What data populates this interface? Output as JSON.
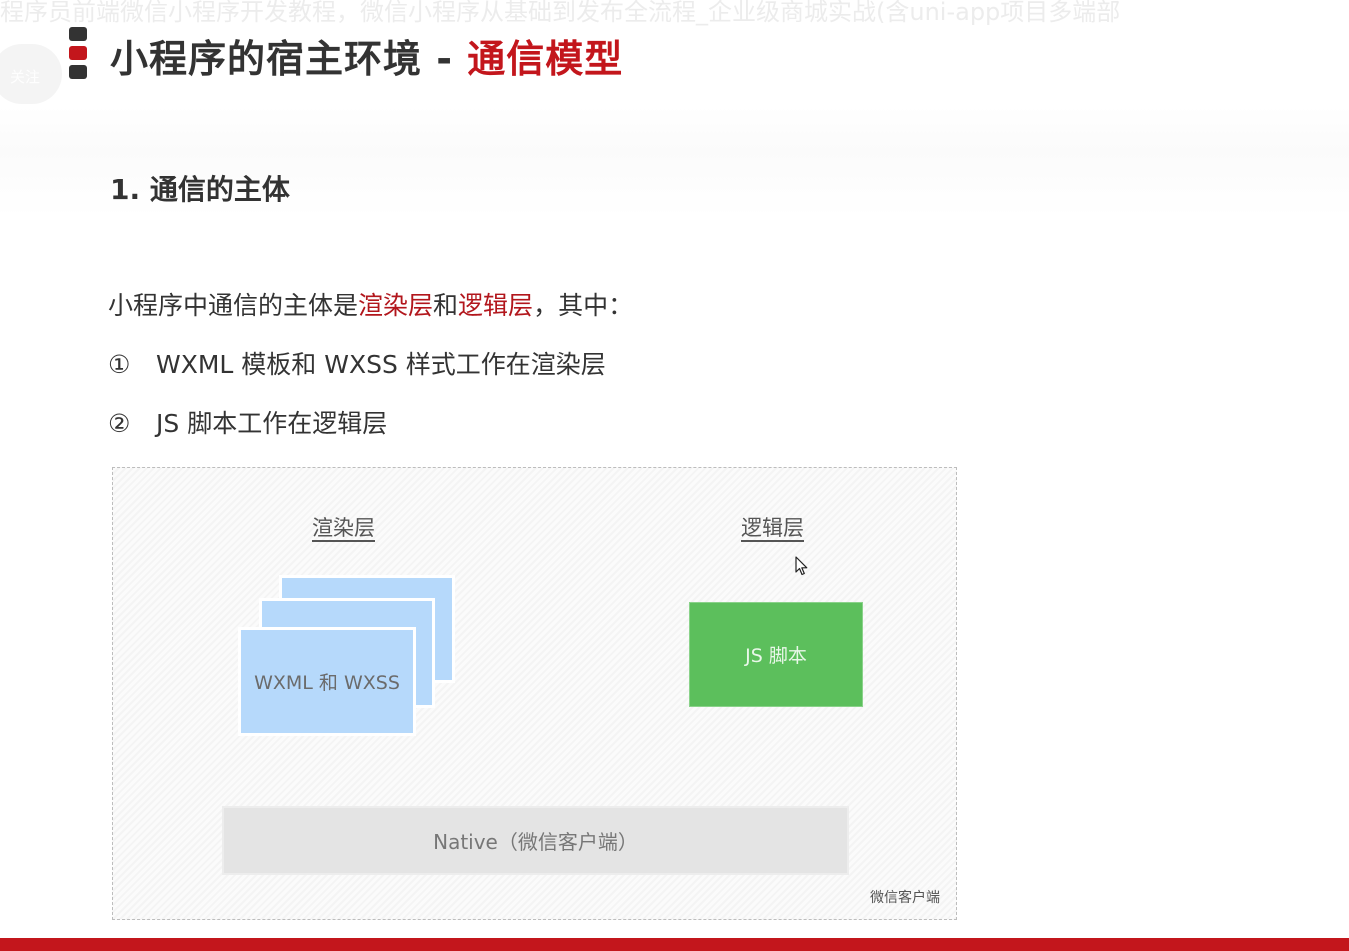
{
  "banner": {
    "text": "程序员前端微信小程序开发教程，微信小程序从基础到发布全流程_企业级商城实战(含uni-app项目多端部"
  },
  "follow": {
    "label": "关注"
  },
  "header": {
    "title_prefix": "小程序的宿主环境 - ",
    "title_accent": "通信模型"
  },
  "section": {
    "heading": "1. 通信的主体"
  },
  "intro": {
    "part1": "小程序中通信的主体是",
    "highlight1": "渲染层",
    "part2": "和",
    "highlight2": "逻辑层",
    "part3": "，其中："
  },
  "bullets": [
    {
      "num": "①",
      "text": "WXML 模板和 WXSS 样式工作在渲染层"
    },
    {
      "num": "②",
      "text": "JS 脚本工作在逻辑层"
    }
  ],
  "diagram": {
    "render_layer": "渲染层",
    "logic_layer": "逻辑层",
    "page_card_label": "WXML 和 WXSS",
    "js_box_label": "JS 脚本",
    "native_label": "Native（微信客户端）",
    "client_caption": "微信客户端"
  },
  "colors": {
    "accent_red": "#c3161c",
    "render_blue": "#b6d9fb",
    "logic_green": "#5cbf5c"
  },
  "icons": {
    "cursor": "mouse-pointer-icon"
  }
}
